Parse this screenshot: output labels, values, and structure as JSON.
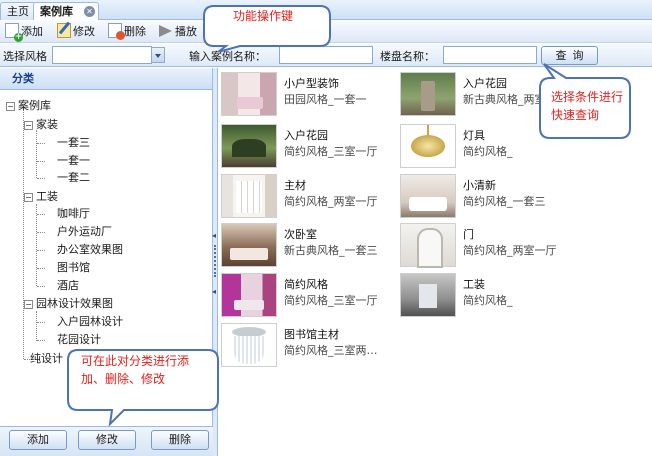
{
  "tabs": {
    "home": "主页",
    "cases": "案例库",
    "close_glyph": "✕"
  },
  "toolbar": {
    "add": "添加",
    "edit": "修改",
    "delete": "删除",
    "play": "播放"
  },
  "callouts": {
    "toolbar_note": "功能操作键",
    "search_note": "选择条件进行快速查询",
    "tree_note": "可在此对分类进行添加、删除、修改"
  },
  "search": {
    "style_label": "选择风格",
    "style_value": "",
    "case_name_label": "输入案例名称：",
    "case_name_value": "",
    "property_label": "楼盘名称：",
    "property_value": "",
    "query_button": "查询"
  },
  "left_panel": {
    "header": "分类",
    "tree": {
      "root": "案例库",
      "home_decor": "家装",
      "home_items": [
        "一套三",
        "一套一",
        "一套二"
      ],
      "tooling": "工装",
      "tooling_items": [
        "咖啡厅",
        "户外运动厂",
        "办公室效果图",
        "图书馆",
        "酒店"
      ],
      "garden": "园林设计效果图",
      "garden_items": [
        "入户园林设计",
        "花园设计"
      ],
      "pure_design": "纯设计"
    },
    "buttons": {
      "add": "添加",
      "edit": "修改",
      "delete": "删除"
    }
  },
  "cases": [
    {
      "title": "小户型装饰",
      "subtitle": "田园风格_一套一"
    },
    {
      "title": "入户花园",
      "subtitle": "新古典风格_两室"
    },
    {
      "title": "入户花园",
      "subtitle": "简约风格_三室一厅"
    },
    {
      "title": "灯具",
      "subtitle": "简约风格_"
    },
    {
      "title": "主材",
      "subtitle": "简约风格_两室一厅"
    },
    {
      "title": "小清新",
      "subtitle": "简约风格_一套三"
    },
    {
      "title": "次卧室",
      "subtitle": "新古典风格_一套三"
    },
    {
      "title": "门",
      "subtitle": "简约风格_两室一厅"
    },
    {
      "title": "简约风格",
      "subtitle": "简约风格_三室一厅"
    },
    {
      "title": "工装",
      "subtitle": "简约风格_"
    },
    {
      "title": "图书馆主材",
      "subtitle": "简约风格_三室两…"
    }
  ],
  "colors": {
    "accent_blue": "#99bbe8",
    "header_text": "#15428b",
    "callout_border": "#4d72b8",
    "callout_text": "#e0221f"
  }
}
